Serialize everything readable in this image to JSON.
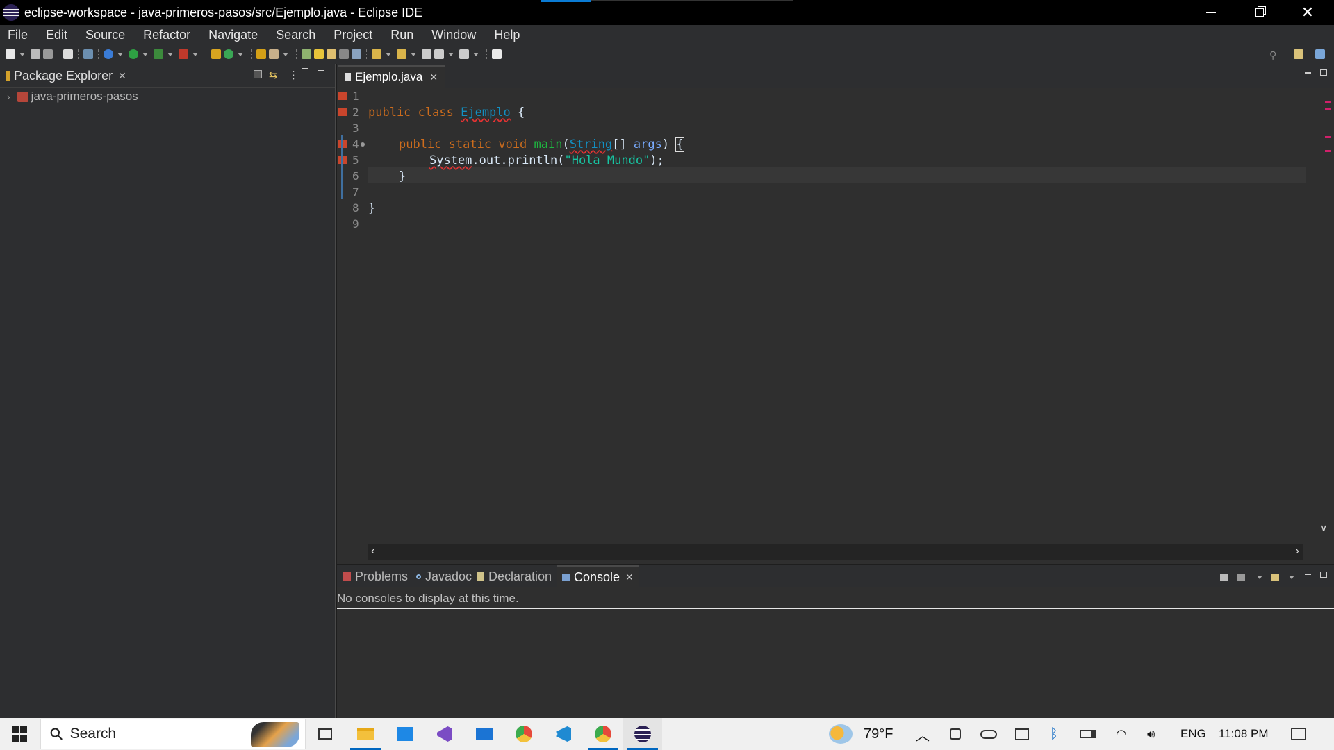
{
  "window": {
    "title": "eclipse-workspace - java-primeros-pasos/src/Ejemplo.java - Eclipse IDE",
    "minimize_icon": "minimize-icon",
    "restore_icon": "restore-icon",
    "close_icon": "close-icon"
  },
  "menu": [
    "File",
    "Edit",
    "Source",
    "Refactor",
    "Navigate",
    "Search",
    "Project",
    "Run",
    "Window",
    "Help"
  ],
  "package_explorer": {
    "tab_label": "Package Explorer",
    "project": "java-primeros-pasos"
  },
  "editor": {
    "tab_label": "Ejemplo.java",
    "lines": [
      "1",
      "2",
      "3",
      "4",
      "5",
      "6",
      "7",
      "8",
      "9"
    ],
    "code": {
      "l2_kw1": "public",
      "l2_kw2": "class",
      "l2_name": "Ejemplo",
      "l2_brace": " {",
      "l4_kw1": "public",
      "l4_kw2": "static",
      "l4_kw3": "void",
      "l4_method": "main",
      "l4_open": "(",
      "l4_type": "String",
      "l4_arr": "[] ",
      "l4_param": "args",
      "l4_close": ") ",
      "l4_brace": "{",
      "l5_system": "System",
      "l5_rest": ".out.println(",
      "l5_string": "\"Hola Mundo\"",
      "l5_end": ");",
      "l6": "}",
      "l8": "}"
    }
  },
  "console": {
    "tabs": [
      "Problems",
      "Javadoc",
      "Declaration",
      "Console"
    ],
    "message": "No consoles to display at this time."
  },
  "taskbar": {
    "search_placeholder": "Search",
    "weather": "79°F",
    "language": "ENG",
    "time": "11:08 PM"
  },
  "colors": {
    "keyword": "#cc6c1d",
    "type": "#1290c3",
    "method": "#1eb540",
    "string": "#17c6a3",
    "error": "#e53232"
  }
}
